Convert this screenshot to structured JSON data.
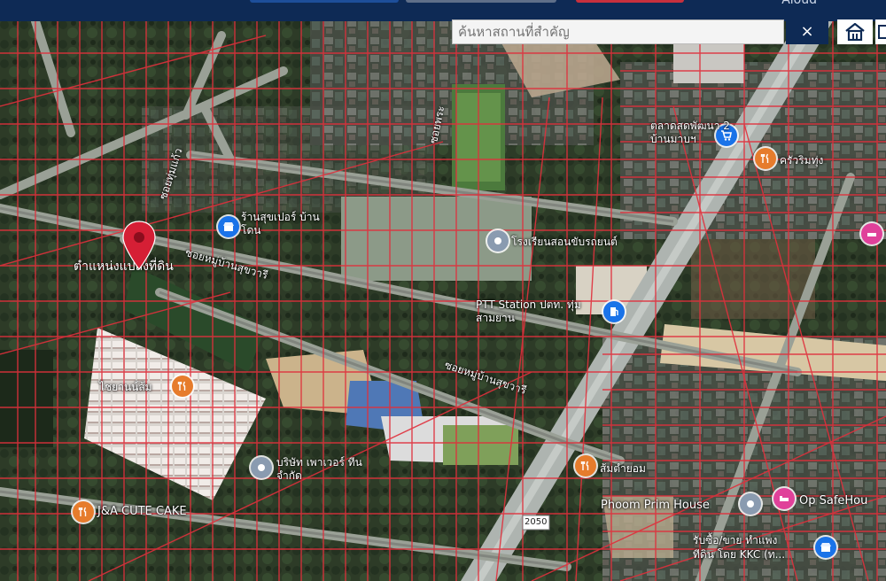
{
  "topbar": {
    "login_text": "Aloud"
  },
  "search": {
    "placeholder": "ค้นหาสถานที่สำคัญ",
    "clear_label": "×"
  },
  "marker": {
    "label": "ตำแหน่งแปลงที่ดิน"
  },
  "roads": {
    "soi_a": "ซอยทุ่มแก้ว",
    "soi_b": "ซอยหมู่บ้านสุขวารี",
    "soi_c": "ซอยหมู่บ้านสุขวารี",
    "route": "2050",
    "soi_d": "ซอยพระ"
  },
  "places": {
    "market": "ตลาดสดพัฒนา 2 บ้านมาบฯ",
    "restaurant_top": "ครัวริมทุ่ง",
    "shop": "ร้านสุขเปอร์ บ้านโดน",
    "school": "โรงเรียนสอนขับรถยนต์",
    "ptt": "PTT Station ปตท. ทุ่มสามยาน",
    "resto_left": "ไชยานน์ส้ม",
    "company": "บริษัท เพาเวอร์ ทีน จำกัด",
    "cake": "J&A CUTE CAKE",
    "resto_bottom": "ส้มตำยอม",
    "phoom": "Phoom Prim House",
    "op_safe": "Op SafeHou",
    "kkc": "รับซื้อ/ขาย ทำแพง ทีดิน โดย KKC (ท...",
    "kkc1": "รับซื้อ/ขาย ทำแพง",
    "kkc2": "ทีดิน โดย KKC (ท..."
  },
  "colors": {
    "accent": "#0e2a55",
    "parcel_line": "#d92b38",
    "marker": "#d51f35",
    "poi_orange": "#e67c2c",
    "poi_blue": "#1a73e8",
    "poi_pink": "#e0419a",
    "poi_gray": "#8a9bb0"
  },
  "icons": {
    "marker": "location-pin-icon",
    "home": "home-icon",
    "clear": "close-icon"
  }
}
